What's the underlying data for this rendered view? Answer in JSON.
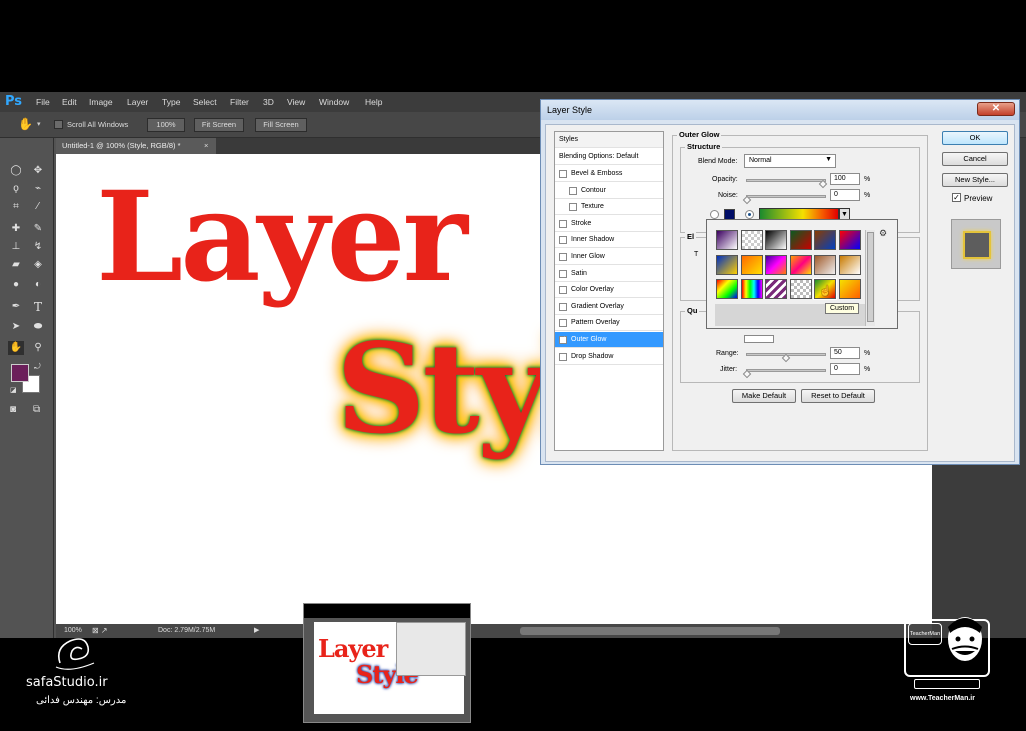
{
  "app": {
    "logo": "Ps",
    "menus": [
      "File",
      "Edit",
      "Image",
      "Layer",
      "Type",
      "Select",
      "Filter",
      "3D",
      "View",
      "Window",
      "Help"
    ],
    "options": {
      "scroll_all_windows": "Scroll All Windows",
      "zoom_btn": "100%",
      "fit_screen": "Fit Screen",
      "fill_screen": "Fill Screen"
    },
    "doc_tab": "Untitled-1 @ 100% (Style, RGB/8) *",
    "doc_tab_close": "×",
    "canvas_text": {
      "line1": "Layer",
      "line2": "Style"
    },
    "status": {
      "zoom": "100%",
      "doc": "Doc: 2.79M/2.75M"
    }
  },
  "dialog": {
    "title": "Layer Style",
    "close": "✕",
    "styles_header": "Styles",
    "blending": "Blending Options: Default",
    "styles": [
      {
        "label": "Bevel & Emboss",
        "checked": false,
        "indent": false
      },
      {
        "label": "Contour",
        "checked": false,
        "indent": true
      },
      {
        "label": "Texture",
        "checked": false,
        "indent": true
      },
      {
        "label": "Stroke",
        "checked": false,
        "indent": false
      },
      {
        "label": "Inner Shadow",
        "checked": false,
        "indent": false
      },
      {
        "label": "Inner Glow",
        "checked": false,
        "indent": false
      },
      {
        "label": "Satin",
        "checked": false,
        "indent": false
      },
      {
        "label": "Color Overlay",
        "checked": false,
        "indent": false
      },
      {
        "label": "Gradient Overlay",
        "checked": false,
        "indent": false
      },
      {
        "label": "Pattern Overlay",
        "checked": false,
        "indent": false
      },
      {
        "label": "Outer Glow",
        "checked": true,
        "indent": false,
        "selected": true
      },
      {
        "label": "Drop Shadow",
        "checked": false,
        "indent": false
      }
    ],
    "outer_glow": {
      "section": "Outer Glow",
      "structure": "Structure",
      "blend_mode_label": "Blend Mode:",
      "blend_mode": "Normal",
      "opacity_label": "Opacity:",
      "opacity": "100",
      "noise_label": "Noise:",
      "noise": "0",
      "pct": "%",
      "elements_label": "El",
      "t_label": "T",
      "quality_label": "Qu",
      "range_label": "Range:",
      "range": "50",
      "jitter_label": "Jitter:",
      "jitter": "0"
    },
    "buttons": {
      "ok": "OK",
      "cancel": "Cancel",
      "new_style": "New Style...",
      "preview": "Preview",
      "make_default": "Make Default",
      "reset_default": "Reset to Default"
    },
    "preview_checked": true
  },
  "picker": {
    "tooltip": "Custom",
    "gear": "⚙"
  },
  "branding": {
    "left": "safaStudio.ir",
    "left_sub": "مدرس: مهندس فدائی",
    "right": "www.TeacherMan.ir",
    "right_logo": "TeacherMan"
  },
  "colors": {
    "ps_blue": "#31a8ff",
    "text_red": "#e8231a",
    "selected_blue": "#3399ff",
    "foreground": "#6b1f5a",
    "glow_swatch": "#000d66"
  }
}
